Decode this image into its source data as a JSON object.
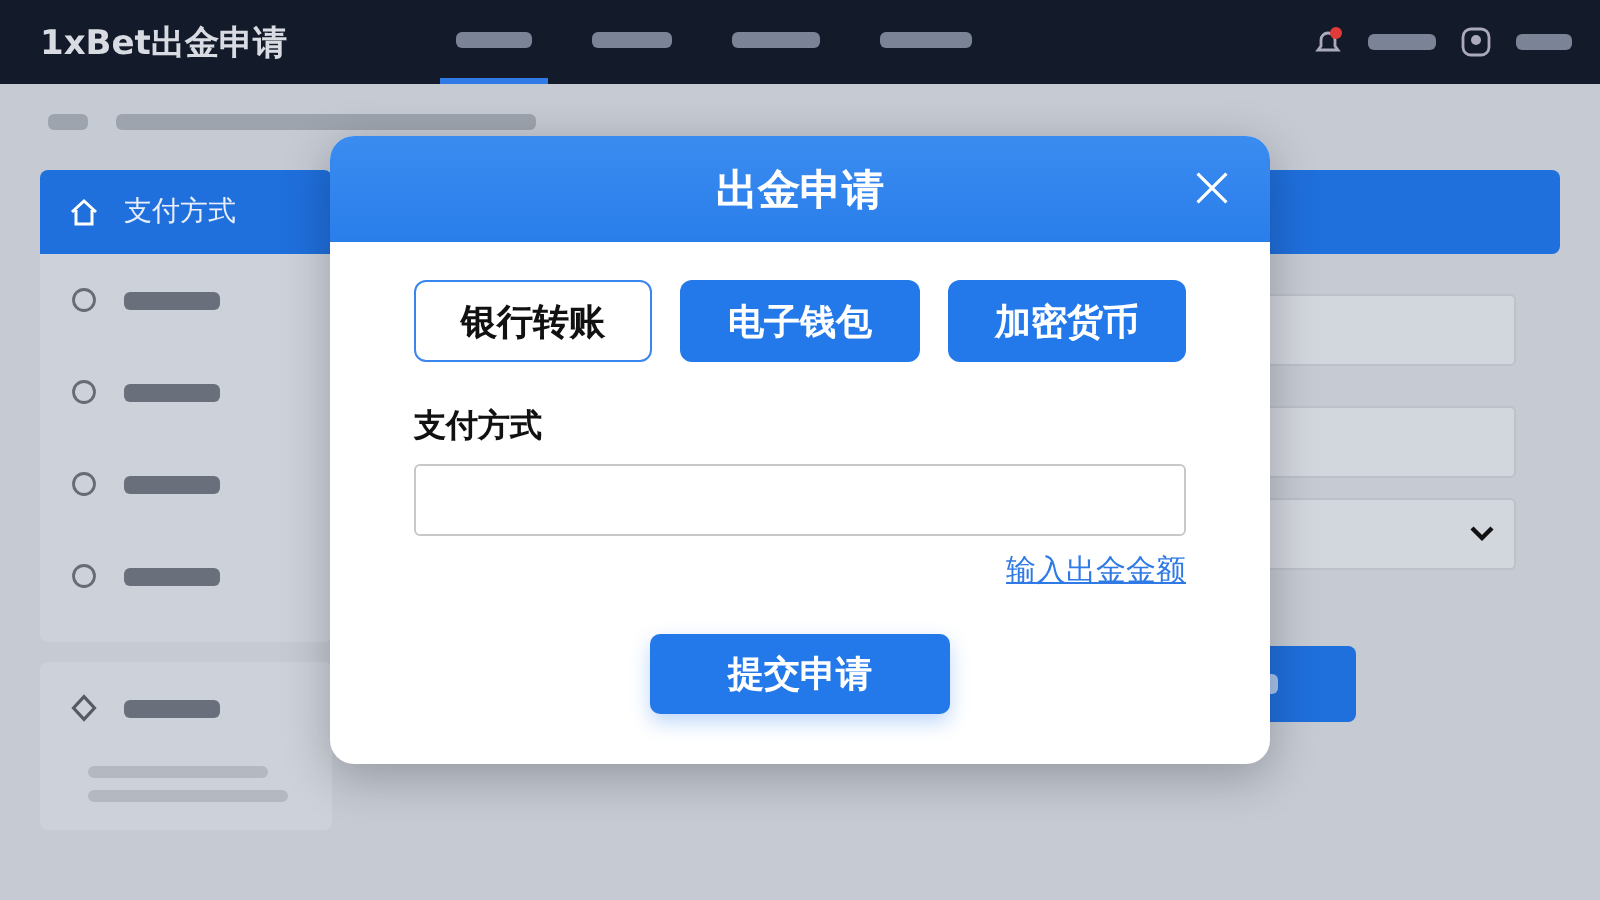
{
  "app": {
    "brand": "1xBet出金申请"
  },
  "nav_tabs": [
    {
      "selected": true
    },
    {
      "selected": false
    },
    {
      "selected": false
    },
    {
      "selected": false
    }
  ],
  "sidebar": {
    "items": [
      {
        "label": "支付方式",
        "selected": true
      },
      {
        "selected": false
      },
      {
        "selected": false
      },
      {
        "selected": false
      },
      {
        "selected": false
      }
    ]
  },
  "dialog": {
    "title": "出金申请",
    "methods": [
      {
        "label": "银行转账",
        "selected": true
      },
      {
        "label": "电子钱包",
        "selected": false
      },
      {
        "label": "加密货币",
        "selected": false
      }
    ],
    "field_label": "支付方式",
    "link": "输入出金金额",
    "submit": "提交申请"
  }
}
